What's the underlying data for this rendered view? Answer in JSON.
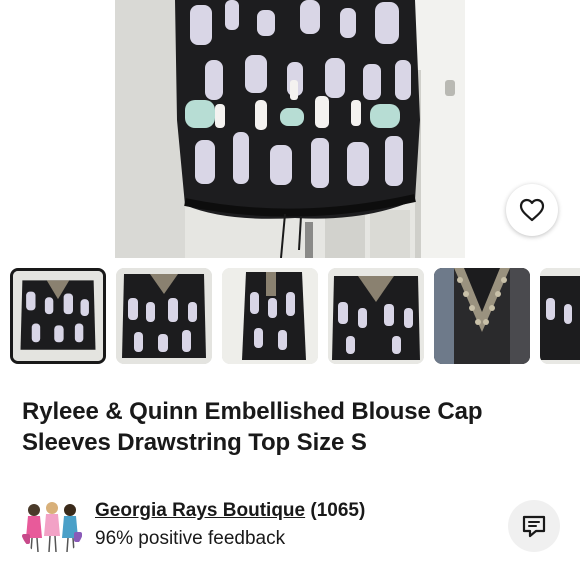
{
  "listing": {
    "title": "Ryleee & Quinn Embellished Blouse Cap Sleeves Drawstring Top Size S"
  },
  "gallery": {
    "favorite_icon": "heart-outline-icon",
    "thumbnail_count_visible": 6,
    "selected_index": 0
  },
  "seller": {
    "name": "Georgia Rays Boutique",
    "feedback_count": "(1065)",
    "positive_feedback": "96% positive feedback",
    "message_icon": "message-icon"
  },
  "colors": {
    "text": "#191919",
    "button_bg": "#f0f0f0",
    "selected_border": "#191919"
  }
}
